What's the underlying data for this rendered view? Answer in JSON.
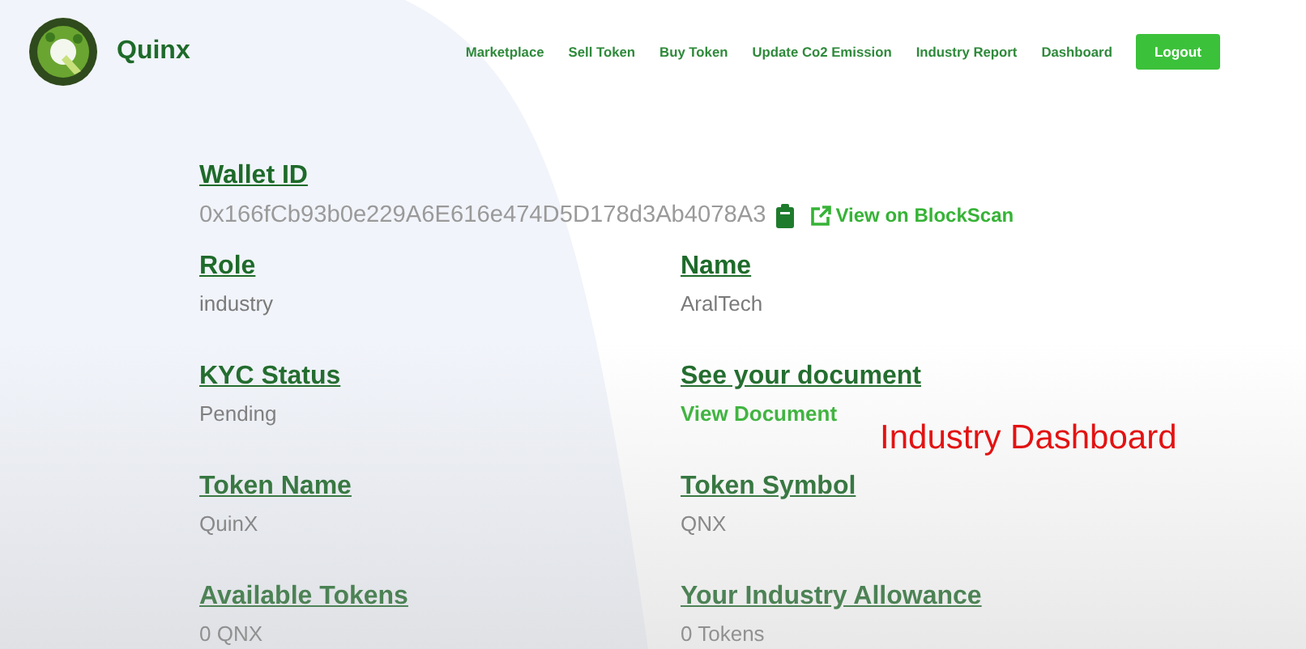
{
  "header": {
    "brand": "Quinx",
    "nav": [
      "Marketplace",
      "Sell Token",
      "Buy Token",
      "Update Co2 Emission",
      "Industry Report",
      "Dashboard"
    ],
    "logout": "Logout"
  },
  "wallet": {
    "label": "Wallet ID",
    "address": "0x166fCb93b0e229A6E616e474D5D178d3Ab4078A3",
    "link": "View on BlockScan"
  },
  "fields": [
    {
      "label": "Role",
      "value": "industry",
      "kind": "text"
    },
    {
      "label": "Name",
      "value": "AralTech",
      "kind": "text"
    },
    {
      "label": "KYC Status",
      "value": "Pending",
      "kind": "text"
    },
    {
      "label": "See your document",
      "value": "View Document",
      "kind": "link"
    },
    {
      "label": "Token Name",
      "value": "QuinX",
      "kind": "text"
    },
    {
      "label": "Token Symbol",
      "value": "QNX",
      "kind": "text"
    },
    {
      "label": "Available Tokens",
      "value": "0 QNX",
      "kind": "text"
    },
    {
      "label": "Your Industry Allowance",
      "value": "0 Tokens",
      "kind": "text"
    }
  ],
  "caption": "Industry Dashboard"
}
